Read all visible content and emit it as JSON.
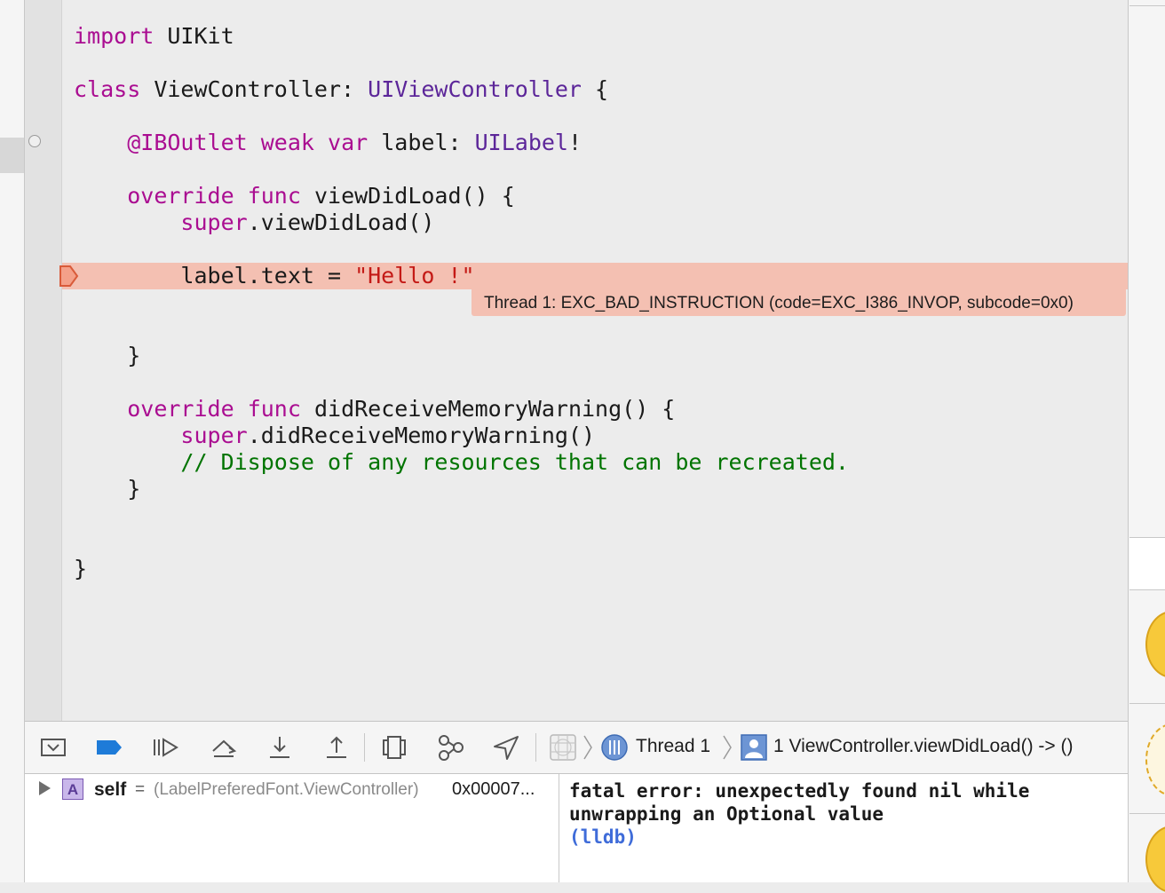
{
  "editor": {
    "lines": [
      {
        "id": "l1",
        "parts": [
          {
            "t": "import",
            "c": "kw"
          },
          {
            "t": " UIKit",
            "c": ""
          }
        ]
      },
      {
        "id": "l2",
        "parts": [
          {
            "t": "class",
            "c": "kw"
          },
          {
            "t": " ViewController: ",
            "c": ""
          },
          {
            "t": "UIViewController",
            "c": "ty"
          },
          {
            "t": " {",
            "c": ""
          }
        ]
      },
      {
        "id": "l3",
        "parts": [
          {
            "t": "    ",
            "c": ""
          },
          {
            "t": "@IBOutlet",
            "c": "kw"
          },
          {
            "t": " ",
            "c": ""
          },
          {
            "t": "weak",
            "c": "kw"
          },
          {
            "t": " ",
            "c": ""
          },
          {
            "t": "var",
            "c": "kw"
          },
          {
            "t": " label: ",
            "c": ""
          },
          {
            "t": "UILabel",
            "c": "ty"
          },
          {
            "t": "!",
            "c": ""
          }
        ]
      },
      {
        "id": "l4",
        "parts": [
          {
            "t": "    ",
            "c": ""
          },
          {
            "t": "override",
            "c": "kw"
          },
          {
            "t": " ",
            "c": ""
          },
          {
            "t": "func",
            "c": "kw"
          },
          {
            "t": " viewDidLoad() {",
            "c": ""
          }
        ]
      },
      {
        "id": "l5",
        "parts": [
          {
            "t": "        ",
            "c": ""
          },
          {
            "t": "super",
            "c": "kw"
          },
          {
            "t": ".viewDidLoad()",
            "c": ""
          }
        ]
      },
      {
        "id": "l6",
        "parts": [
          {
            "t": "        label.text = ",
            "c": ""
          },
          {
            "t": "\"Hello !\"",
            "c": "st"
          }
        ]
      },
      {
        "id": "l7",
        "parts": [
          {
            "t": "    }",
            "c": ""
          }
        ]
      },
      {
        "id": "l8",
        "parts": [
          {
            "t": "    ",
            "c": ""
          },
          {
            "t": "override",
            "c": "kw"
          },
          {
            "t": " ",
            "c": ""
          },
          {
            "t": "func",
            "c": "kw"
          },
          {
            "t": " didReceiveMemoryWarning() {",
            "c": ""
          }
        ]
      },
      {
        "id": "l9",
        "parts": [
          {
            "t": "        ",
            "c": ""
          },
          {
            "t": "super",
            "c": "kw"
          },
          {
            "t": ".didReceiveMemoryWarning()",
            "c": ""
          }
        ]
      },
      {
        "id": "l10",
        "parts": [
          {
            "t": "        ",
            "c": ""
          },
          {
            "t": "// Dispose of any resources that can be recreated.",
            "c": "cm"
          }
        ]
      },
      {
        "id": "l11",
        "parts": [
          {
            "t": "    }",
            "c": ""
          }
        ]
      },
      {
        "id": "l12",
        "parts": [
          {
            "t": "}",
            "c": ""
          }
        ]
      }
    ],
    "error_message": "Thread 1: EXC_BAD_INSTRUCTION (code=EXC_I386_INVOP, subcode=0x0)"
  },
  "debug_bar": {
    "buttons": [
      {
        "name": "hide-debug-area-button",
        "icon": "panel-toggle-icon"
      },
      {
        "name": "breakpoints-toggle-button",
        "icon": "breakpoint-icon"
      },
      {
        "name": "continue-button",
        "icon": "continue-icon"
      },
      {
        "name": "step-over-button",
        "icon": "step-over-icon"
      },
      {
        "name": "step-into-button",
        "icon": "step-into-icon"
      },
      {
        "name": "step-out-button",
        "icon": "step-out-icon"
      },
      {
        "name": "view-hierarchy-button",
        "icon": "view-hierarchy-icon"
      },
      {
        "name": "memory-graph-button",
        "icon": "memory-graph-icon"
      },
      {
        "name": "simulate-location-button",
        "icon": "location-icon"
      }
    ],
    "thread": "Thread 1",
    "frame": "1 ViewController.viewDidLoad() -> ()"
  },
  "variables": {
    "name": "self",
    "equals": "=",
    "type": "(LabelPreferedFont.ViewController)",
    "value": "0x00007...",
    "icon_letter": "A"
  },
  "console": {
    "line1": "fatal error: unexpectedly found nil while",
    "line2": "unwrapping an Optional value",
    "prompt": "(lldb)"
  },
  "colors": {
    "keyword": "#aa0d91",
    "type": "#5c2699",
    "string": "#c41a16",
    "comment": "#007400",
    "error_band": "#f4c0b2",
    "accent_blue": "#1e7bd8"
  }
}
